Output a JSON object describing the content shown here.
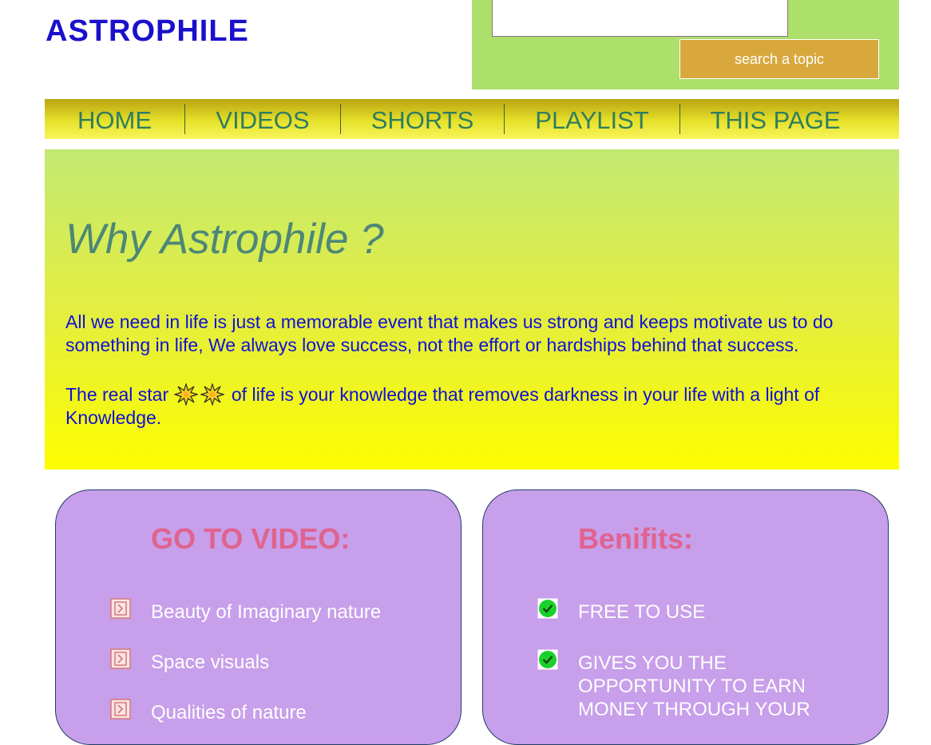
{
  "header": {
    "logo": "ASTROPHILE",
    "search_placeholder": "",
    "search_button": "search a topic"
  },
  "nav": {
    "items": [
      "HOME",
      "VIDEOS",
      "SHORTS",
      "PLAYLIST",
      "THIS PAGE"
    ]
  },
  "hero": {
    "title": "Why Astrophile ?",
    "paragraph1": "All we need in life is just a memorable event that makes us strong and keeps motivate us to do something in life, We always love success, not the effort or hardships behind that success.",
    "paragraph2_before": "The real star",
    "paragraph2_after": "of life is your knowledge that removes darkness in your life with a light of Knowledge.",
    "icons": [
      "sparkle-star-icon",
      "sparkle-star-icon"
    ]
  },
  "videos_card": {
    "title": "GO TO VIDEO:",
    "items": [
      "Beauty of Imaginary nature",
      "Space visuals",
      "Qualities of nature"
    ],
    "item_icon": "link-icon"
  },
  "benefits_card": {
    "title": "Benifits:",
    "items": [
      "FREE TO USE",
      "GIVES YOU THE OPPORTUNITY TO EARN MONEY THROUGH YOUR"
    ],
    "item_icon": "green-check-icon"
  },
  "colors": {
    "logo": "#1a10cc",
    "search_panel": "#addf6b",
    "search_button": "#d8a83c",
    "nav_text": "#2f7d5f",
    "hero_title": "#4d8777",
    "hero_text": "#1010d8",
    "card_bg": "#c79fea",
    "card_title": "#e0638f"
  }
}
